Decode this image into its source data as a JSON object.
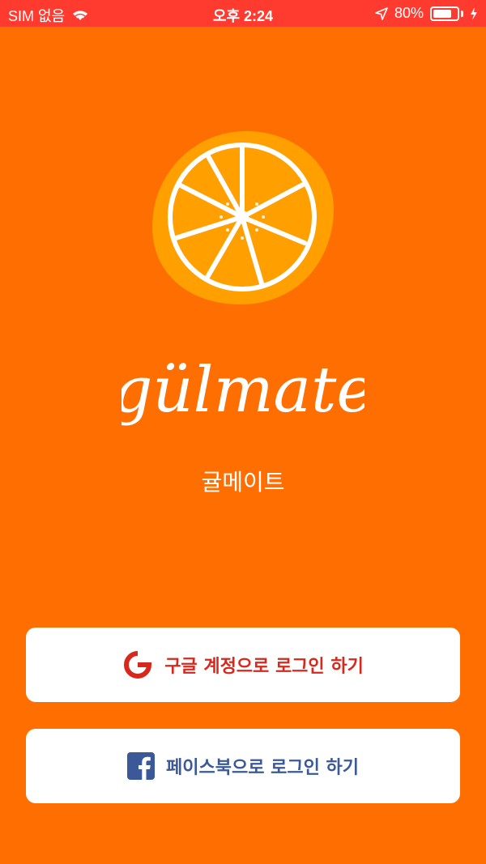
{
  "status_bar": {
    "carrier": "SIM 없음",
    "time": "오후 2:24",
    "battery": "80%",
    "battery_level": 0.8,
    "icons": [
      "wifi-icon",
      "location-arrow-icon",
      "battery-icon",
      "charging-bolt-icon"
    ]
  },
  "app": {
    "logo_icon": "orange-slice-icon",
    "wordmark": "gülmate",
    "subtitle": "귤메이트"
  },
  "buttons": {
    "google": {
      "label": "구글 계정으로 로그인 하기",
      "icon": "google-g-icon",
      "color": "#d7281d"
    },
    "facebook": {
      "label": "페이스북으로 로그인 하기",
      "icon": "facebook-icon",
      "color": "#3b5998"
    }
  },
  "colors": {
    "background": "#ff6e00",
    "status_bar": "#ff3b30",
    "orange_flesh": "#ff9f00",
    "button_bg": "#ffffff"
  }
}
